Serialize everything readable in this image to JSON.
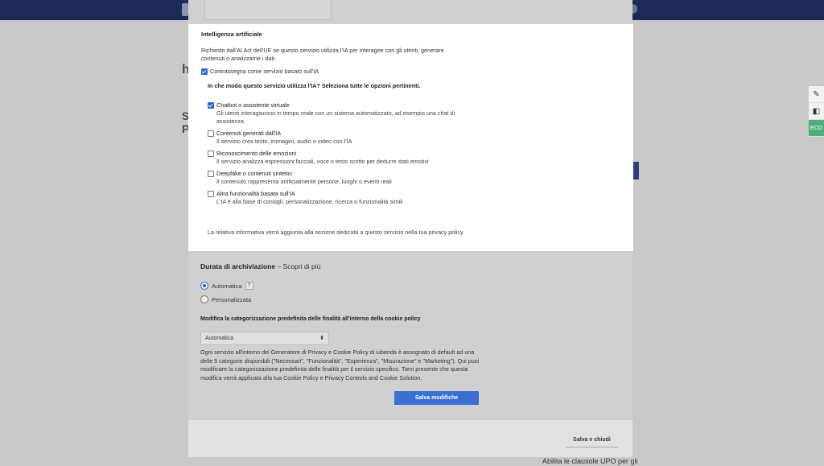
{
  "background": {
    "heading_fragment_1": "h",
    "heading_fragment_2": "S",
    "heading_fragment_3": "P",
    "footer_text": "Abilita le clausole UPO per gli"
  },
  "side_tabs": [
    "✎",
    "◧",
    "ECO"
  ],
  "ai_section": {
    "title": "Intelligenza artificiale",
    "description": "Richiesto dall'AI Act dell'UE se questo servizio utilizza l'IA per interagire con gli utenti, generare contenuti o analizzarne i dati.",
    "mark_label": "Contrassegna come servizio basato sull'IA",
    "mark_checked": true,
    "question": "In che modo questo servizio utilizza l'IA? Seleziona tutte le opzioni pertinenti.",
    "options": [
      {
        "label": "Chatbot o assistente virtuale",
        "desc": "Gli utenti interagiscono in tempo reale con un sistema automatizzato, ad esempio una chat di assistenza",
        "checked": true
      },
      {
        "label": "Contenuti generati dall'IA",
        "desc": "Il servizio crea testo, immagini, audio o video con l'IA",
        "checked": false
      },
      {
        "label": "Riconoscimento delle emozioni",
        "desc": "Il servizio analizza espressioni facciali, voce o testo scritto per dedurre stati emotivi",
        "checked": false
      },
      {
        "label": "Deepfake o contenuti sintetici",
        "desc": "Il contenuto rappresenta artificialmente persone, luoghi o eventi reali",
        "checked": false
      },
      {
        "label": "Altra funzionalità basata sull'IA",
        "desc": "L'IA è alla base di consigli, personalizzazione, ricerca o funzionalità simili",
        "checked": false
      }
    ],
    "info": "La relativa informativa verrà aggiunta alla sezione dedicata a questo servizio nella tua privacy policy."
  },
  "retention": {
    "title": "Durata di archiviazione",
    "link": "Scopri di più",
    "options": [
      {
        "label": "Automatica",
        "selected": true,
        "help": "?"
      },
      {
        "label": "Personalizzata",
        "selected": false
      }
    ]
  },
  "categorization": {
    "title": "Modifica la categorizzazione predefinita delle finalità all'interno della cookie policy",
    "select_value": "Automatica",
    "paragraph": "Ogni servizio all'interno del Generatore di Privacy e Cookie Policy di iubenda è assegnato di default ad una delle 5 categorie disponibili (\"Necessari\", \"Funzionalità\", \"Esperienza\", \"Misurazione\" e \"Marketing\"). Qui puoi modificare la categorizzazione predefinita delle finalità per il servizio specifico. Tieni presente che questa modifica verrà applicata alla tua Cookie Policy e Privacy Controls and Cookie Solution."
  },
  "buttons": {
    "save_changes": "Salva modifiche",
    "save_close": "Salva e chiudi"
  },
  "colors": {
    "accent": "#3a6fd1",
    "topbar": "#1d2a57",
    "eco_tab": "#4caf7d"
  }
}
